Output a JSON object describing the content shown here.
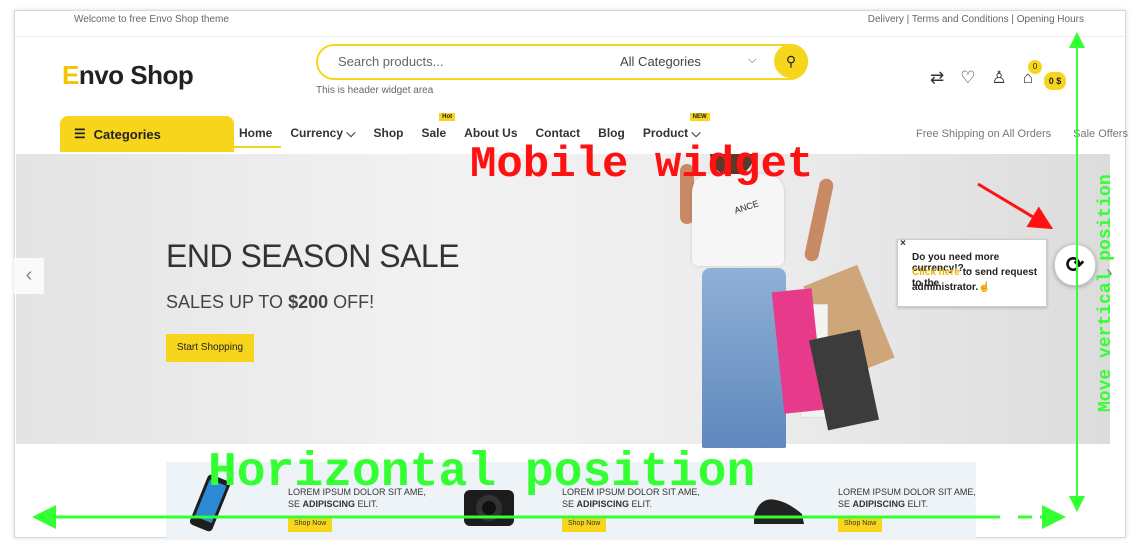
{
  "topbar": {
    "welcome": "Welcome to free Envo Shop theme",
    "links": "Delivery | Terms and Conditions | Opening Hours"
  },
  "header": {
    "logo_e": "E",
    "logo_rest": "nvo Shop",
    "search_placeholder": "Search products...",
    "category_select": "All Categories",
    "widget_area": "This is header widget area",
    "cart_count": "0",
    "cart_amount": "0 $"
  },
  "nav": {
    "categories_button": "Categories",
    "items": [
      "Home",
      "Currency",
      "Shop",
      "Sale",
      "About Us",
      "Contact",
      "Blog",
      "Product"
    ],
    "tags": {
      "sale": "Hot",
      "product": "NEW"
    },
    "right": [
      "Free Shipping on All Orders",
      "Sale Offers"
    ]
  },
  "hero": {
    "title": "END SEASON SALE",
    "sub_prefix": "SALES UP TO ",
    "sub_amount": "$200",
    "sub_suffix": " OFF!",
    "button": "Start Shopping",
    "shirt_text": "ANCE"
  },
  "popup": {
    "close": "×",
    "line1": "Do you need more currency!?...",
    "link": "Click here",
    "line2_rest": " to send request to the",
    "line3": "administrator."
  },
  "products": [
    {
      "line1": "LOREM IPSUM DOLOR SIT AME,",
      "prefix": "SE ",
      "bold": "ADIPISCING",
      "suffix": " ELIT.",
      "button": "Shop Now"
    },
    {
      "line1": "LOREM IPSUM DOLOR SIT AME,",
      "prefix": "SE ",
      "bold": "ADIPISCING",
      "suffix": " ELIT.",
      "button": "Shop Now"
    },
    {
      "line1": "LOREM IPSUM DOLOR SIT AME,",
      "prefix": "SE ",
      "bold": "ADIPISCING",
      "suffix": " ELIT.",
      "button": "Shop Now"
    }
  ],
  "annotations": {
    "mobile": "Mobile widget",
    "horizontal": "Horizontal position",
    "vertical": "Move vertical position"
  },
  "colors": {
    "accent": "#f7d51d",
    "annotation_red": "#ff1111",
    "annotation_green": "#33ff33"
  }
}
